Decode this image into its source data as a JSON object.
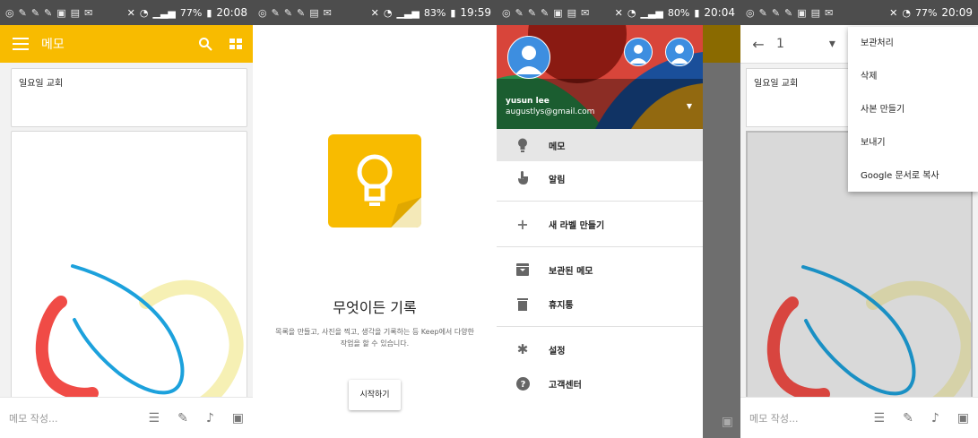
{
  "panel1": {
    "status": {
      "battery": "77%",
      "time": "20:08"
    },
    "appbar": {
      "title": "메모"
    },
    "note": {
      "title": "일요일 교회"
    },
    "bottom": {
      "placeholder": "메모 작성..."
    }
  },
  "panel2": {
    "status": {
      "battery": "83%",
      "time": "19:59"
    },
    "heading": "무엇이든 기록",
    "description_line1": "목록을 만들고, 사진을 찍고, 생각을 기록하는 등 Keep에서 다양한",
    "description_line2": "작업을 할 수 있습니다.",
    "start_button": "시작하기"
  },
  "panel3": {
    "status": {
      "battery": "80%",
      "time": "20:04"
    },
    "account": {
      "name": "yusun lee",
      "email": "augustlys@gmail.com"
    },
    "menu": [
      {
        "label": "메모",
        "icon": "lightbulb-icon"
      },
      {
        "label": "알림",
        "icon": "reminder-hand-icon"
      },
      {
        "label": "새 라벨 만들기",
        "icon": "plus-icon"
      },
      {
        "label": "보관된 메모",
        "icon": "archive-icon"
      },
      {
        "label": "휴지통",
        "icon": "trash-icon"
      },
      {
        "label": "설정",
        "icon": "gear-icon"
      },
      {
        "label": "고객센터",
        "icon": "help-icon"
      }
    ]
  },
  "panel4": {
    "status": {
      "battery": "77%",
      "time": "20:09"
    },
    "toolbar": {
      "count": "1"
    },
    "note": {
      "title": "일요일 교회"
    },
    "bottom": {
      "placeholder": "메모 작성..."
    },
    "overflow_menu": [
      "보관처리",
      "삭제",
      "사본 만들기",
      "보내기",
      "Google 문서로 복사"
    ]
  },
  "colors": {
    "accent": "#f8bb00",
    "statusbar": "#4d4d4d",
    "red_stroke": "#f04b46",
    "blue_stroke": "#1ca1dc",
    "yellow_stroke": "#f6f0b4"
  }
}
